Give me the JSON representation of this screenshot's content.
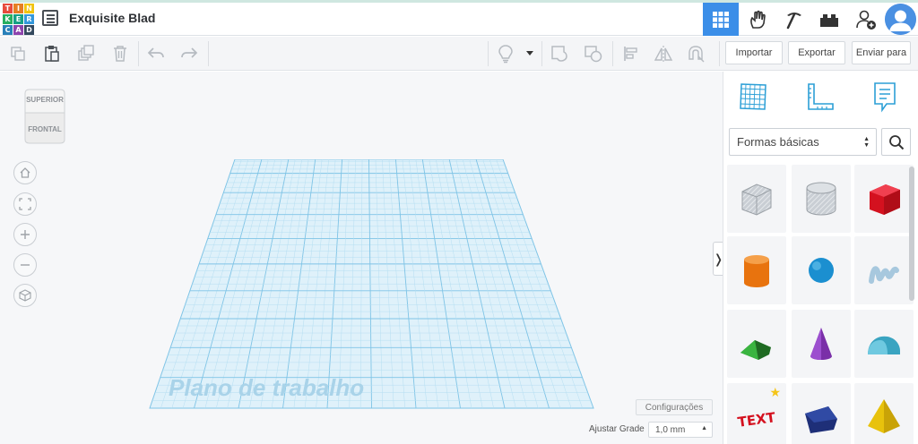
{
  "app": {
    "logo_letters": [
      "T",
      "I",
      "N",
      "K",
      "E",
      "R",
      "C",
      "A",
      "D"
    ],
    "logo_colors": [
      "#e74c3c",
      "#e67e22",
      "#f1c40f",
      "#27ae60",
      "#16a085",
      "#3498db",
      "#2980b9",
      "#8e44ad",
      "#34495e"
    ],
    "design_title": "Exquisite Blad"
  },
  "header": {
    "buttons": [
      {
        "name": "3d-view-button",
        "icon": "grid-icon",
        "active": true
      },
      {
        "name": "circuits-button",
        "icon": "hand-icon",
        "active": false
      },
      {
        "name": "codeblocks-button",
        "icon": "pickaxe-icon",
        "active": false
      },
      {
        "name": "bricks-button",
        "icon": "bricks-icon",
        "active": false
      },
      {
        "name": "share-button",
        "icon": "add-user-icon",
        "active": false
      }
    ],
    "accent": "#3b8ee8"
  },
  "toolbar": {
    "import_label": "Importar",
    "export_label": "Exportar",
    "send_label": "Enviar para"
  },
  "workspace": {
    "viewcube_top": "SUPERIOR",
    "viewcube_front": "FRONTAL",
    "workplane_label": "Plano de trabalho",
    "settings_label": "Configurações",
    "snap_label": "Ajustar Grade",
    "snap_value": "1,0 mm"
  },
  "panel": {
    "category": "Formas básicas",
    "shapes": [
      {
        "name": "shape-box-hole",
        "icon": "box-hole-icon"
      },
      {
        "name": "shape-cylinder-hole",
        "icon": "cylinder-hole-icon"
      },
      {
        "name": "shape-box",
        "icon": "red-box-icon"
      },
      {
        "name": "shape-cylinder",
        "icon": "orange-cylinder-icon"
      },
      {
        "name": "shape-sphere",
        "icon": "blue-sphere-icon"
      },
      {
        "name": "shape-scribble",
        "icon": "scribble-icon"
      },
      {
        "name": "shape-roof",
        "icon": "green-roof-icon"
      },
      {
        "name": "shape-cone",
        "icon": "purple-cone-icon"
      },
      {
        "name": "shape-round-roof",
        "icon": "teal-round-roof-icon"
      },
      {
        "name": "shape-text",
        "icon": "text-3d-icon"
      },
      {
        "name": "shape-polygon",
        "icon": "navy-polygon-icon"
      },
      {
        "name": "shape-pyramid",
        "icon": "yellow-pyramid-icon"
      }
    ]
  }
}
